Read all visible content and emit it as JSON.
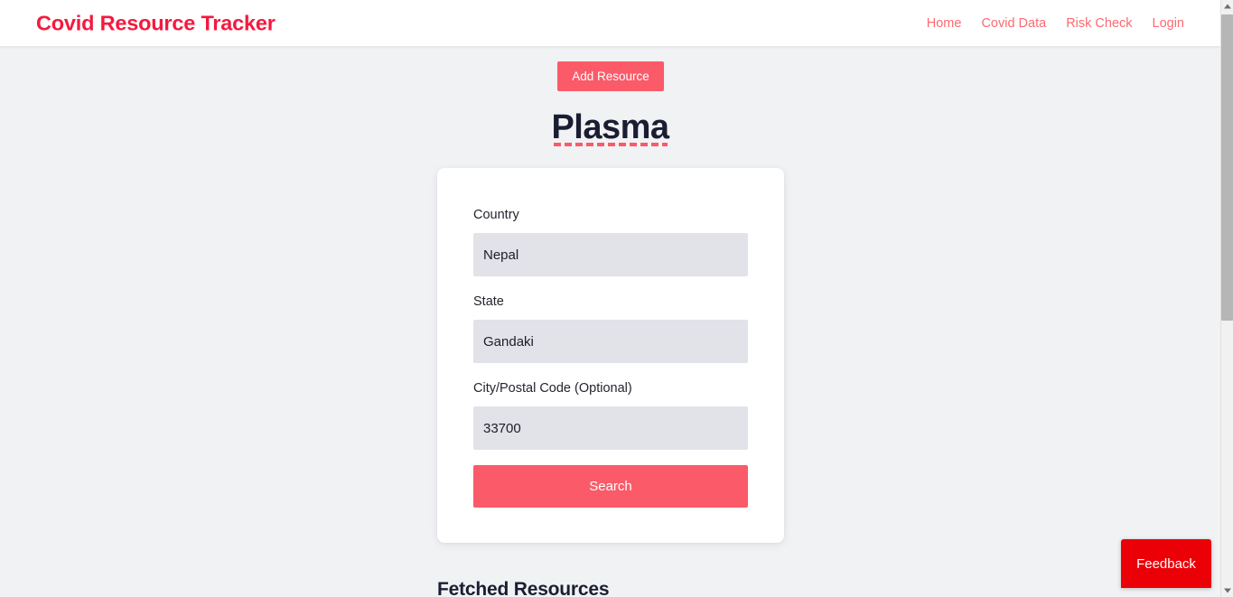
{
  "navbar": {
    "brand": "Covid Resource Tracker",
    "links": [
      {
        "label": "Home"
      },
      {
        "label": "Covid Data"
      },
      {
        "label": "Risk Check"
      },
      {
        "label": "Login"
      }
    ],
    "brand_color": "#f4193e",
    "link_color": "#fc6a72"
  },
  "actions": {
    "add_resource_label": "Add Resource"
  },
  "page": {
    "title": "Plasma",
    "title_color": "#1b1e32",
    "accent_color": "#fb5a68",
    "background_color": "#f1f2f4"
  },
  "form": {
    "fields": [
      {
        "label": "Country",
        "value": "Nepal",
        "placeholder": "Country"
      },
      {
        "label": "State",
        "value": "Gandaki",
        "placeholder": "State"
      },
      {
        "label": "City/Postal Code (Optional)",
        "value": "33700",
        "placeholder": "City/Postal Code (Optional)"
      }
    ],
    "submit_label": "Search",
    "input_background": "#e2e3e9"
  },
  "results": {
    "heading": "Fetched Resources"
  },
  "feedback": {
    "label": "Feedback",
    "color": "#ec0008"
  },
  "scrollbar": {
    "up_icon": "chevron-up-icon",
    "down_icon": "chevron-down-icon"
  }
}
